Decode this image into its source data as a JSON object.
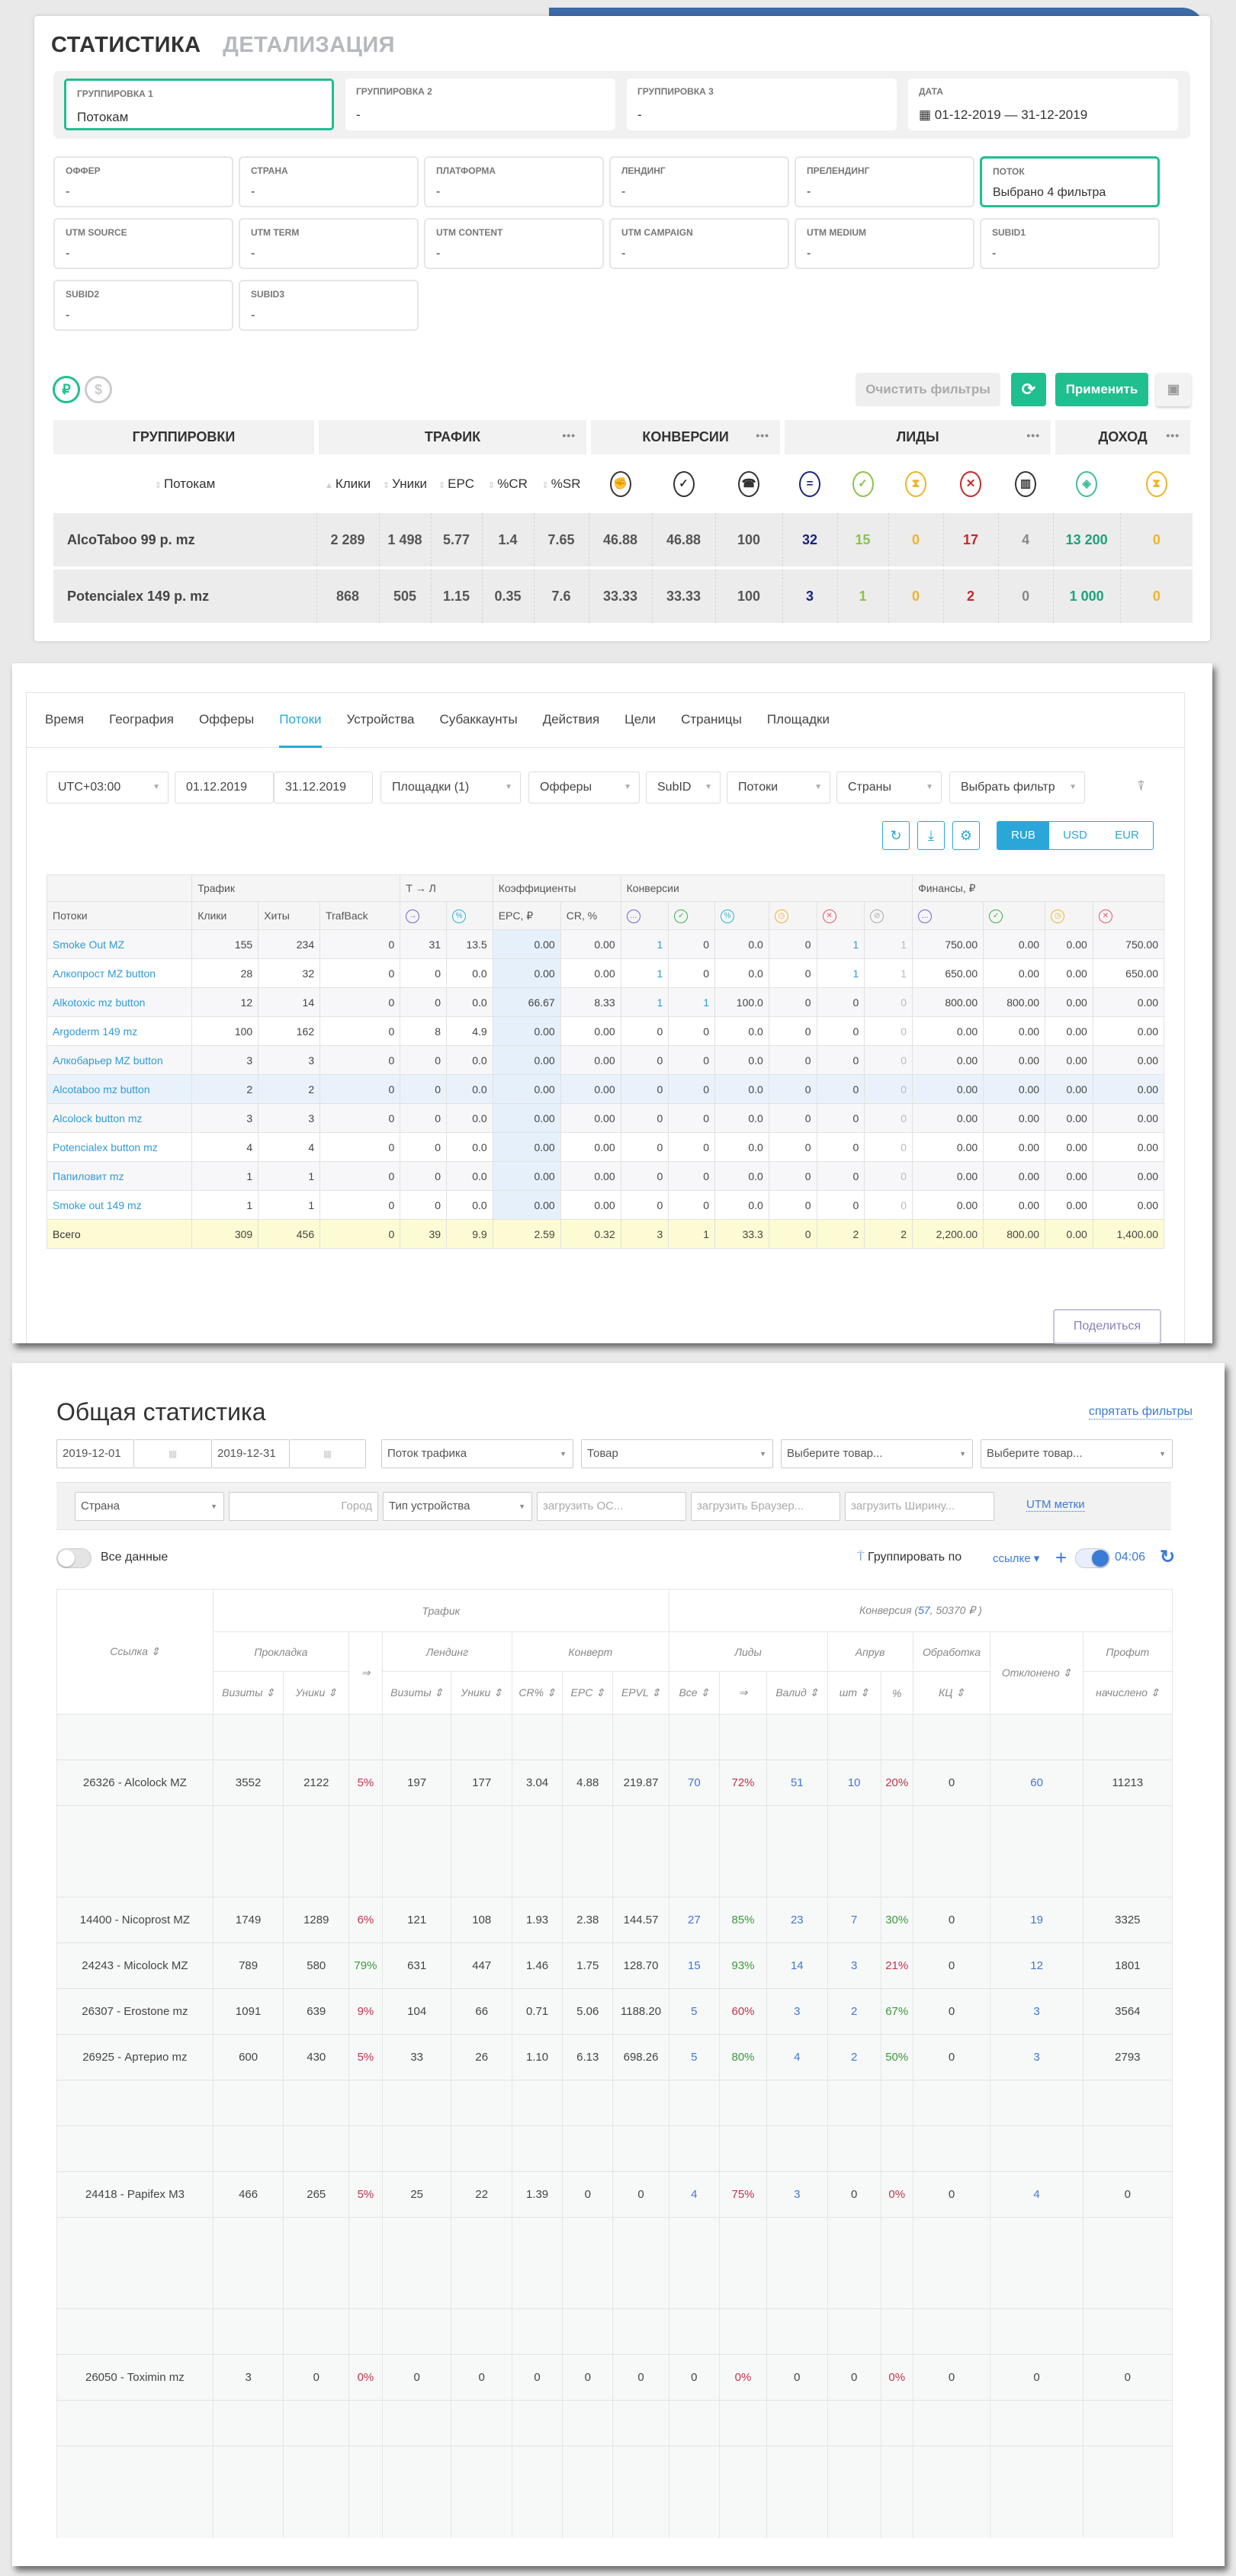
{
  "stats_panel": {
    "tabs": [
      "СТАТИСТИКА",
      "ДЕТАЛИЗАЦИЯ"
    ],
    "groupings": [
      {
        "label": "ГРУППИРОВКА 1",
        "value": "Потокам"
      },
      {
        "label": "ГРУППИРОВКА 2",
        "value": "-"
      },
      {
        "label": "ГРУППИРОВКА 3",
        "value": "-"
      },
      {
        "label": "ДАТА",
        "value": "01-12-2019 — 31-12-2019"
      }
    ],
    "filters": [
      {
        "label": "ОФФЕР",
        "value": "-"
      },
      {
        "label": "СТРАНА",
        "value": "-"
      },
      {
        "label": "ПЛАТФОРМА",
        "value": "-"
      },
      {
        "label": "ЛЕНДИНГ",
        "value": "-"
      },
      {
        "label": "ПРЕЛЕНДИНГ",
        "value": "-"
      },
      {
        "label": "ПОТОК",
        "value": "Выбрано 4 фильтра"
      },
      {
        "label": "UTM SOURCE",
        "value": "-"
      },
      {
        "label": "UTM TERM",
        "value": "-"
      },
      {
        "label": "UTM CONTENT",
        "value": "-"
      },
      {
        "label": "UTM CAMPAIGN",
        "value": "-"
      },
      {
        "label": "UTM MEDIUM",
        "value": "-"
      },
      {
        "label": "SUBID1",
        "value": "-"
      },
      {
        "label": "SUBID2",
        "value": "-"
      },
      {
        "label": "SUBID3",
        "value": "-"
      }
    ],
    "currency_rub": "₽",
    "currency_usd": "$",
    "clear_label": "Очистить фильтры",
    "refresh_icon": "⟳",
    "apply_label": "Применить",
    "save_icon": "▣",
    "group_headers": [
      "ГРУППИРОВКИ",
      "ТРАФИК",
      "КОНВЕРСИИ",
      "ЛИДЫ",
      "ДОХОД"
    ],
    "dots": "•••",
    "sub_headers": [
      "Потокам",
      "Клики",
      "Уники",
      "EPC",
      "%CR",
      "%SR"
    ],
    "icons": [
      {
        "name": "thumb-icon",
        "glyph": "✊",
        "color": "#333333"
      },
      {
        "name": "check-percent-icon",
        "glyph": "✓",
        "color": "#333333"
      },
      {
        "name": "phone-icon",
        "glyph": "☎",
        "color": "#333333"
      },
      {
        "name": "equals-icon",
        "glyph": "=",
        "color": "#1a237e"
      },
      {
        "name": "check-icon",
        "glyph": "✓",
        "color": "#8bc34a"
      },
      {
        "name": "hourglass-icon",
        "glyph": "⧗",
        "color": "#f0b429"
      },
      {
        "name": "x-icon",
        "glyph": "✕",
        "color": "#c62828"
      },
      {
        "name": "trash-icon",
        "glyph": "▥",
        "color": "#333333"
      },
      {
        "name": "money-icon",
        "glyph": "◈",
        "color": "#3fbf9a"
      },
      {
        "name": "hourglass-icon",
        "glyph": "⧗",
        "color": "#f0b429"
      }
    ],
    "rows": [
      [
        "AlcoTaboo 99 р. mz",
        "2 289",
        "1 498",
        "5.77",
        "1.4",
        "7.65",
        "46.88",
        "46.88",
        "100",
        "32",
        "15",
        "0",
        "17",
        "4",
        "13 200",
        "0"
      ],
      [
        "Potencialex 149 р. mz",
        "868",
        "505",
        "1.15",
        "0.35",
        "7.6",
        "33.33",
        "33.33",
        "100",
        "3",
        "1",
        "0",
        "2",
        "0",
        "1 000",
        "0"
      ]
    ],
    "value_colors": [
      "#444444",
      "#555555",
      "#555555",
      "#555555",
      "#555555",
      "#555555",
      "#555555",
      "#555555",
      "#555555",
      "#1a237e",
      "#8bc34a",
      "#f0b429",
      "#c62828",
      "#888888",
      "#1aa37a",
      "#f0b429"
    ]
  },
  "streams_panel": {
    "tabs": [
      "Время",
      "География",
      "Офферы",
      "Потоки",
      "Устройства",
      "Субаккаунты",
      "Действия",
      "Цели",
      "Страницы",
      "Площадки"
    ],
    "active_tab": "Потоки",
    "filters": [
      "UTC+03:00",
      "01.12.2019",
      "31.12.2019",
      "Площадки (1)",
      "Офферы",
      "SubID",
      "Потоки",
      "Страны",
      "Выбрать фильтр"
    ],
    "currencies": [
      "RUB",
      "USD",
      "EUR"
    ],
    "header_groups": [
      "Трафик",
      "Т → Л",
      "Коэффициенты",
      "Конверсии",
      "Финансы, ₽"
    ],
    "header_cols": [
      "Потоки",
      "Клики",
      "Хиты",
      "TrafBack",
      "EPC, ₽",
      "CR, %"
    ],
    "header_icons": [
      {
        "glyph": "→",
        "color": "#7b5fd6"
      },
      {
        "glyph": "%",
        "color": "#2fb0d8"
      },
      {
        "glyph": "…",
        "color": "#7b5fd6"
      },
      {
        "glyph": "✓",
        "color": "#3cb44b"
      },
      {
        "glyph": "%",
        "color": "#2fb0d8"
      },
      {
        "glyph": "◷",
        "color": "#f0b429"
      },
      {
        "glyph": "✕",
        "color": "#e5566b"
      },
      {
        "glyph": "⊘",
        "color": "#aaaaaa"
      },
      {
        "glyph": "…",
        "color": "#7b5fd6"
      },
      {
        "glyph": "✓",
        "color": "#3cb44b"
      },
      {
        "glyph": "◷",
        "color": "#f0b429"
      },
      {
        "glyph": "✕",
        "color": "#e5566b"
      }
    ],
    "rows": [
      [
        "Smoke Out MZ",
        "155",
        "234",
        "0",
        "31",
        "13.5",
        "0.00",
        "0.00",
        "1",
        "0",
        "0.0",
        "0",
        "1",
        "1",
        "750.00",
        "0.00",
        "0.00",
        "750.00"
      ],
      [
        "Алкопрост MZ button",
        "28",
        "32",
        "0",
        "0",
        "0.0",
        "0.00",
        "0.00",
        "1",
        "0",
        "0.0",
        "0",
        "1",
        "1",
        "650.00",
        "0.00",
        "0.00",
        "650.00"
      ],
      [
        "Alkotoxic mz button",
        "12",
        "14",
        "0",
        "0",
        "0.0",
        "66.67",
        "8.33",
        "1",
        "1",
        "100.0",
        "0",
        "0",
        "0",
        "800.00",
        "800.00",
        "0.00",
        "0.00"
      ],
      [
        "Argoderm 149 mz",
        "100",
        "162",
        "0",
        "8",
        "4.9",
        "0.00",
        "0.00",
        "0",
        "0",
        "0.0",
        "0",
        "0",
        "0",
        "0.00",
        "0.00",
        "0.00",
        "0.00"
      ],
      [
        "Алкобарьер MZ button",
        "3",
        "3",
        "0",
        "0",
        "0.0",
        "0.00",
        "0.00",
        "0",
        "0",
        "0.0",
        "0",
        "0",
        "0",
        "0.00",
        "0.00",
        "0.00",
        "0.00"
      ],
      [
        "Alcotaboo mz button",
        "2",
        "2",
        "0",
        "0",
        "0.0",
        "0.00",
        "0.00",
        "0",
        "0",
        "0.0",
        "0",
        "0",
        "0",
        "0.00",
        "0.00",
        "0.00",
        "0.00"
      ],
      [
        "Alcolock button mz",
        "3",
        "3",
        "0",
        "0",
        "0.0",
        "0.00",
        "0.00",
        "0",
        "0",
        "0.0",
        "0",
        "0",
        "0",
        "0.00",
        "0.00",
        "0.00",
        "0.00"
      ],
      [
        "Potencialex button mz",
        "4",
        "4",
        "0",
        "0",
        "0.0",
        "0.00",
        "0.00",
        "0",
        "0",
        "0.0",
        "0",
        "0",
        "0",
        "0.00",
        "0.00",
        "0.00",
        "0.00"
      ],
      [
        "Папиловит mz",
        "1",
        "1",
        "0",
        "0",
        "0.0",
        "0.00",
        "0.00",
        "0",
        "0",
        "0.0",
        "0",
        "0",
        "0",
        "0.00",
        "0.00",
        "0.00",
        "0.00"
      ],
      [
        "Smoke out 149 mz",
        "1",
        "1",
        "0",
        "0",
        "0.0",
        "0.00",
        "0.00",
        "0",
        "0",
        "0.0",
        "0",
        "0",
        "0",
        "0.00",
        "0.00",
        "0.00",
        "0.00"
      ]
    ],
    "total": [
      "Всего",
      "309",
      "456",
      "0",
      "39",
      "9.9",
      "2.59",
      "0.32",
      "3",
      "1",
      "33.3",
      "0",
      "2",
      "2",
      "2,200.00",
      "800.00",
      "0.00",
      "1,400.00"
    ],
    "share_label": "Поделиться"
  },
  "general_panel": {
    "title": "Общая статистика",
    "hide_filters": "спрятать фильтры",
    "date_from": "2019-12-01",
    "date_to": "2019-12-31",
    "selects": [
      "Поток трафика",
      "Товар",
      "Выберите товар...",
      "Выберите товар..."
    ],
    "filters2": {
      "country": "Страна",
      "city": "Город",
      "device": "Тип устройства",
      "os": "загрузить ОС...",
      "browser": "загрузить Браузер...",
      "width": "загрузить Ширину...",
      "utm": "UTM метки"
    },
    "all_data": "Все данные",
    "group_by": "Группировать по",
    "group_value": "ссылке",
    "time": "04:06",
    "head": {
      "link": "Ссылка",
      "traffic": "Трафик",
      "conv_prefix": "Конверсия (",
      "conv_count": "57",
      "conv_sum": ", 50370 ₽ )",
      "prokladka": "Прокладка",
      "arrow": "⇒",
      "landing": "Лендинг",
      "konvert": "Конверт",
      "leads": "Лиды",
      "aprove": "Апрув",
      "obrabotka": "Обработка",
      "otkloneno": "Отклонено",
      "profit": "Профит",
      "cols": [
        "Визиты",
        "Уники",
        "Визиты",
        "Уники",
        "CR%",
        "EPC",
        "EPVL",
        "Все",
        "⇒",
        "Валид",
        "шт",
        "%",
        "КЦ",
        "начислено"
      ]
    },
    "rows": [
      {
        "blank": true
      },
      {
        "cells": [
          "26326 - Alcolock MZ",
          "3552",
          "2122",
          "5%",
          "197",
          "177",
          "3.04",
          "4.88",
          "219.87",
          "70",
          "72%",
          "51",
          "10",
          "20%",
          "0",
          "60",
          "11213"
        ],
        "tones": "kkkrkkkkkbrbbrkbk"
      },
      {
        "blank": true,
        "tall": true
      },
      {
        "cells": [
          "14400 - Nicoprost MZ",
          "1749",
          "1289",
          "6%",
          "121",
          "108",
          "1.93",
          "2.38",
          "144.57",
          "27",
          "85%",
          "23",
          "7",
          "30%",
          "0",
          "19",
          "3325"
        ],
        "tones": "kkkrkkkkkbgbbgkbk"
      },
      {
        "cells": [
          "24243 - Micolock MZ",
          "789",
          "580",
          "79%",
          "631",
          "447",
          "1.46",
          "1.75",
          "128.70",
          "15",
          "93%",
          "14",
          "3",
          "21%",
          "0",
          "12",
          "1801"
        ],
        "tones": "kkkgkkkkkbgbbrkbk"
      },
      {
        "cells": [
          "26307 - Erostone mz",
          "1091",
          "639",
          "9%",
          "104",
          "66",
          "0.71",
          "5.06",
          "1188.20",
          "5",
          "60%",
          "3",
          "2",
          "67%",
          "0",
          "3",
          "3564"
        ],
        "tones": "kkkrkkkkkbrbbgkbk"
      },
      {
        "cells": [
          "26925 - Артерио mz",
          "600",
          "430",
          "5%",
          "33",
          "26",
          "1.10",
          "6.13",
          "698.26",
          "5",
          "80%",
          "4",
          "2",
          "50%",
          "0",
          "3",
          "2793"
        ],
        "tones": "kkkrkkkkkbgbbgkbk"
      },
      {
        "blank": true
      },
      {
        "blank": true
      },
      {
        "cells": [
          "24418 - Papifex M3",
          "466",
          "265",
          "5%",
          "25",
          "22",
          "1.39",
          "0",
          "0",
          "4",
          "75%",
          "3",
          "0",
          "0%",
          "0",
          "4",
          "0"
        ],
        "tones": "kkkrkkkkkbrbkrkbk"
      },
      {
        "blank": true,
        "tall": true
      },
      {
        "blank": true
      },
      {
        "cells": [
          "26050 - Toximin mz",
          "3",
          "0",
          "0%",
          "0",
          "0",
          "0",
          "0",
          "0",
          "0",
          "0%",
          "0",
          "0",
          "0%",
          "0",
          "0",
          "0"
        ],
        "tones": "kkkrkkkkkkrkkrkkk"
      },
      {
        "blank": true
      },
      {
        "blank": true,
        "tall": true
      }
    ]
  }
}
